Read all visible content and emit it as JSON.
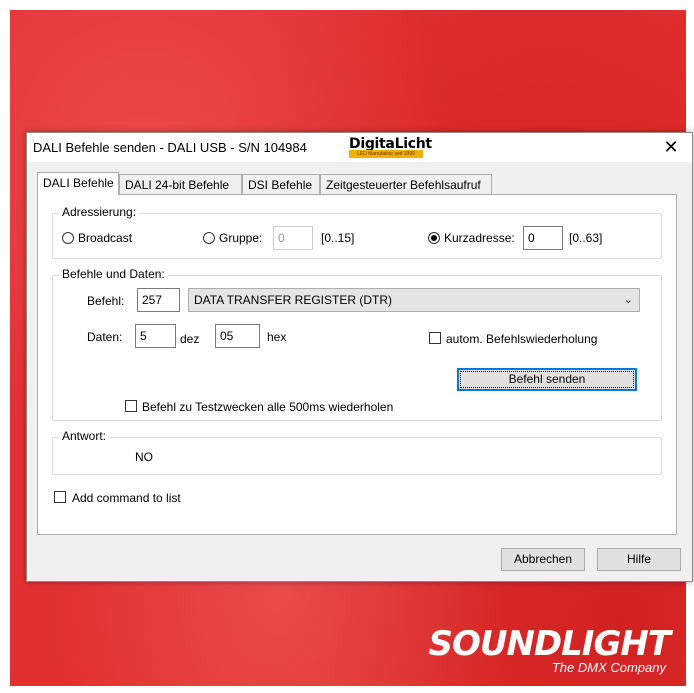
{
  "window": {
    "title": "DALI Befehle senden - DALI USB - S/N 104984",
    "logo_text": "DigitaLicht",
    "logo_tagline": "LED Manufaktur seit 1999",
    "close_glyph": "✕"
  },
  "tabs": [
    {
      "label": "DALI Befehle",
      "active": true
    },
    {
      "label": "DALI 24-bit Befehle",
      "active": false
    },
    {
      "label": "DSI Befehle",
      "active": false
    },
    {
      "label": "Zeitgesteuerter Befehlsaufruf",
      "active": false
    }
  ],
  "addressing": {
    "group_label": "Adressierung:",
    "broadcast_label": "Broadcast",
    "broadcast_checked": false,
    "group_radio_label": "Gruppe:",
    "group_checked": false,
    "group_value": "0",
    "group_range": "[0..15]",
    "short_label": "Kurzadresse:",
    "short_checked": true,
    "short_value": "0",
    "short_range": "[0..63]"
  },
  "commands": {
    "group_label": "Befehle und Daten:",
    "befehl_label": "Befehl:",
    "befehl_value": "257",
    "befehl_selected": "DATA TRANSFER REGISTER (DTR)",
    "daten_label": "Daten:",
    "daten_dec_value": "5",
    "dec_unit": "dez",
    "daten_hex_value": "05",
    "hex_unit": "hex",
    "auto_repeat_label": "autom. Befehlswiederholung",
    "auto_repeat_checked": false,
    "send_button": "Befehl senden",
    "test_repeat_label": "Befehl zu Testzwecken alle 500ms wiederholen",
    "test_repeat_checked": false
  },
  "answer": {
    "group_label": "Antwort:",
    "value": "NO"
  },
  "add_to_list": {
    "label": "Add command to list",
    "checked": false
  },
  "footer": {
    "cancel_button": "Abbrechen",
    "help_button": "Hilfe"
  },
  "branding": {
    "name": "SOUNDLIGHT",
    "tagline": "The DMX Company"
  },
  "colors": {
    "background": "#e23030",
    "focus_blue": "#0078d7"
  }
}
